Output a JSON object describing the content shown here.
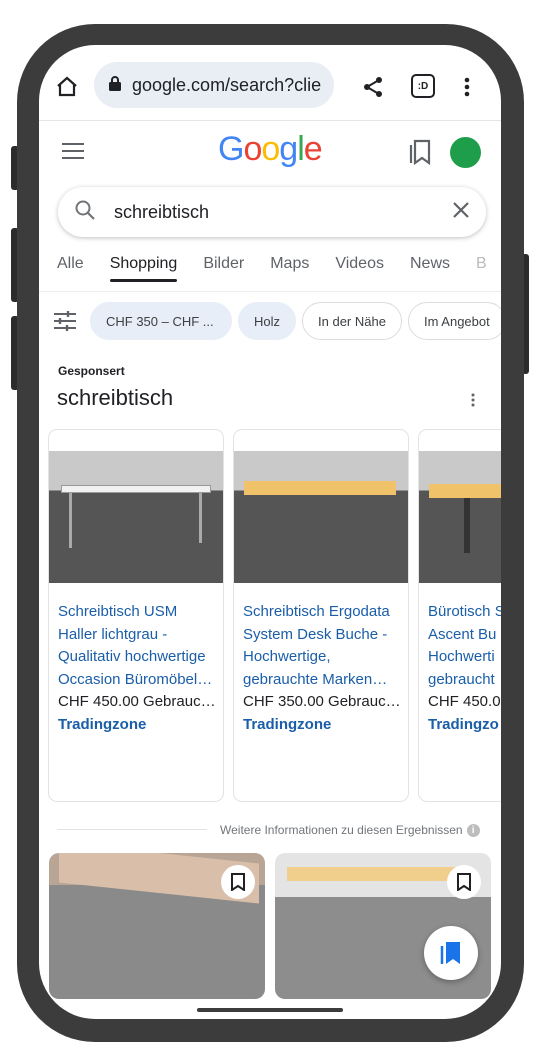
{
  "browser": {
    "url": "google.com/search?clie"
  },
  "header": {
    "logo": "Google",
    "avatar_color": "#1e9e4a"
  },
  "search": {
    "query": "schreibtisch"
  },
  "tabs": [
    "Alle",
    "Shopping",
    "Bilder",
    "Maps",
    "Videos",
    "News",
    "B"
  ],
  "active_tab": "Shopping",
  "chips": [
    "CHF 350 – CHF ...",
    "Holz",
    "In der Nähe",
    "Im Angebot"
  ],
  "sponsored": {
    "label": "Gesponsert",
    "title": "schreibtisch"
  },
  "products": [
    {
      "lines": [
        "Schreibtisch USM",
        "Haller lichtgrau -",
        "Qualitativ hochwertige",
        "Occasion Büromöbel…"
      ],
      "price": "CHF 450.00 Gebrauc…",
      "store": "Tradingzone",
      "desk": "#f2f2f2"
    },
    {
      "lines": [
        "Schreibtisch Ergodata",
        "System Desk Buche -",
        "Hochwertige,",
        "gebrauchte Marken…"
      ],
      "price": "CHF 350.00 Gebrauc…",
      "store": "Tradingzone",
      "desk": "#f0c36a"
    },
    {
      "lines": [
        "Bürotisch S",
        "Ascent Bu",
        "Hochwerti",
        "gebraucht"
      ],
      "price": "CHF 450.0",
      "store": "Tradingzo",
      "desk": "#f0c36a"
    }
  ],
  "more_info": "Weitere Informationen zu diesen Ergebnissen",
  "colors": {
    "link": "#1a5ea8",
    "accent": "#1a73e8"
  }
}
